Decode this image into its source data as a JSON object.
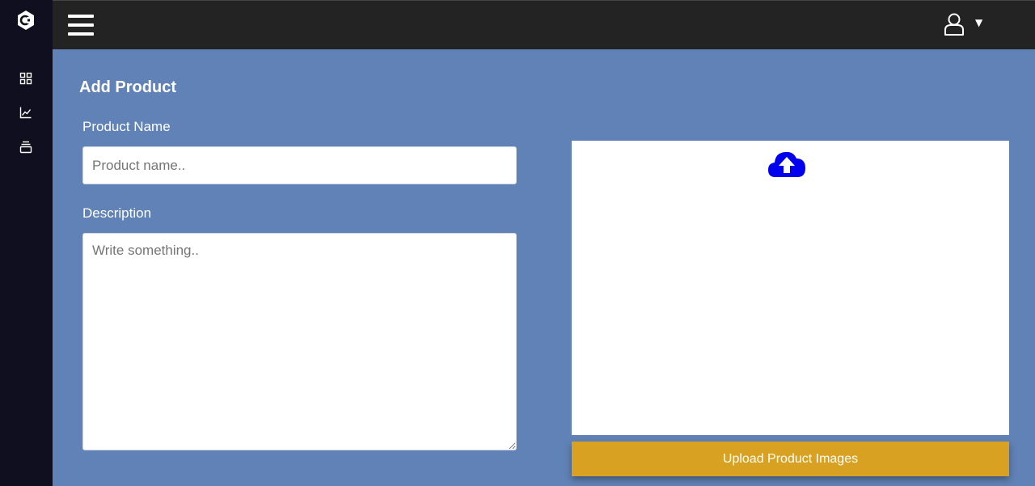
{
  "sidebar": {
    "logo": "brand-c-logo",
    "items": [
      {
        "icon": "grid-icon"
      },
      {
        "icon": "line-chart-icon"
      },
      {
        "icon": "stack-icon"
      }
    ]
  },
  "topbar": {
    "menu_icon": "hamburger-menu-icon",
    "user_icon": "user-icon",
    "caret": "▼"
  },
  "form": {
    "title": "Add Product",
    "product_name_label": "Product Name",
    "product_name_placeholder": "Product name..",
    "product_name_value": "",
    "description_label": "Description",
    "description_placeholder": "Write something..",
    "description_value": ""
  },
  "upload": {
    "icon": "cloud-upload-icon",
    "button_label": "Upload Product Images"
  },
  "colors": {
    "sidebar_bg": "#0f0f1f",
    "topbar_bg": "#232323",
    "page_bg": "#6182b6",
    "upload_icon": "#0000ee",
    "button_bg": "#d9a121"
  }
}
